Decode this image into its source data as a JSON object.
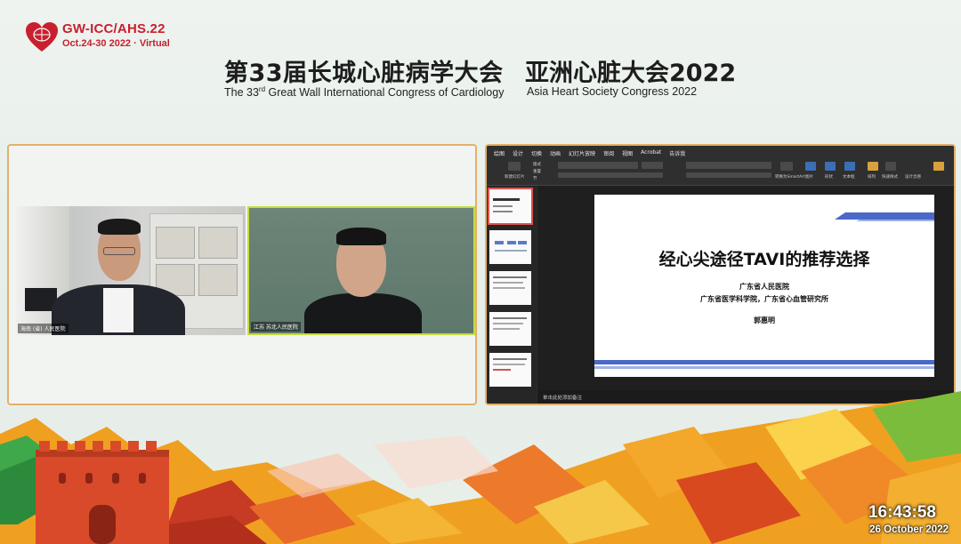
{
  "logo": {
    "title": "GW-ICC/AHS.22",
    "subtitle": "Oct.24-30 2022 · Virtual",
    "heart_color": "#c8202e",
    "icon": "heart-globe-icon"
  },
  "header": {
    "cn_a": "第33届长城心脏病学大会",
    "cn_b": "亚洲心脏大会2022",
    "en_a_pre": "The 33",
    "en_a_sup": "rd",
    "en_a_post": " Great Wall International Congress of Cardiology",
    "en_b": "Asia Heart Society Congress 2022"
  },
  "videos": [
    {
      "name_tag": "海南 (省) 人民医院"
    },
    {
      "name_tag": "江苏 苏北人民医院"
    }
  ],
  "ppt": {
    "tabs": [
      "绘图",
      "设计",
      "切换",
      "动画",
      "幻灯片放映",
      "审阅",
      "视图",
      "Acrobat",
      "告诉我"
    ],
    "ribbon_labels": [
      "新建幻灯片",
      "版式",
      "重置",
      "节",
      "转换为SmartArt",
      "图片",
      "形状",
      "文本框",
      "排列",
      "快速样式",
      "设计灵感"
    ],
    "slide": {
      "title": "经心尖途径TAVI的推荐选择",
      "hospital": "广东省人民医院",
      "institute": "广东省医学科学院，广东省心血管研究所",
      "speaker": "郭惠明"
    },
    "notes_placeholder": "单击此处添加备注",
    "accent_color": "#4a69c9"
  },
  "clock": {
    "time": "16:43:58",
    "date": "26 October 2022"
  },
  "colors": {
    "panel_border": "#e3b06a",
    "active_video_border": "#c8dc3c",
    "wall_red": "#d94a2a",
    "foliage_orange": "#f0a020"
  }
}
